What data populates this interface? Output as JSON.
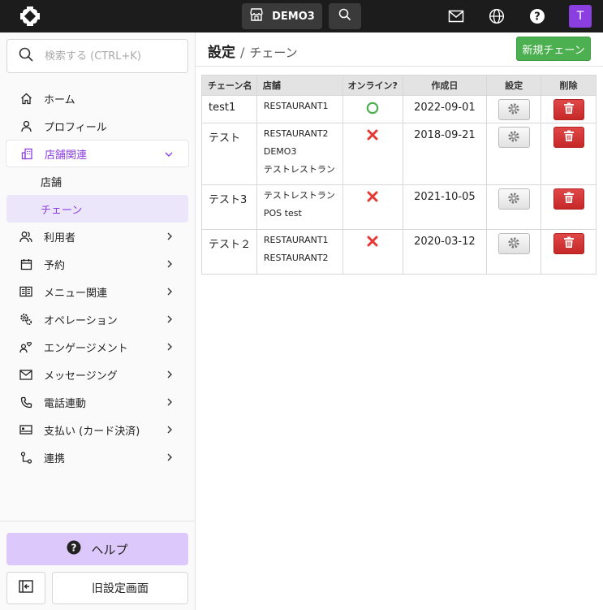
{
  "topbar": {
    "store_name": "DEMO3",
    "avatar_initial": "T"
  },
  "sidebar": {
    "search_placeholder": "検索する (CTRL+K)",
    "items": [
      {
        "label": "ホーム",
        "icon": "home-icon"
      },
      {
        "label": "プロフィール",
        "icon": "person-icon"
      },
      {
        "label": "店舗関連",
        "icon": "building-icon",
        "expanded": true
      },
      {
        "label": "利用者",
        "icon": "users-icon"
      },
      {
        "label": "予約",
        "icon": "calendar-icon"
      },
      {
        "label": "メニュー関連",
        "icon": "menu-book-icon"
      },
      {
        "label": "オペレーション",
        "icon": "gears-icon"
      },
      {
        "label": "エンゲージメント",
        "icon": "engagement-icon"
      },
      {
        "label": "メッセージング",
        "icon": "mail-icon"
      },
      {
        "label": "電話連動",
        "icon": "phone-icon"
      },
      {
        "label": "支払い (カード決済)",
        "icon": "payment-icon"
      },
      {
        "label": "連携",
        "icon": "integration-icon"
      }
    ],
    "sub_items": [
      {
        "label": "店舗",
        "active": false
      },
      {
        "label": "チェーン",
        "active": true
      }
    ],
    "help_label": "ヘルプ",
    "old_settings_label": "旧設定画面"
  },
  "main": {
    "breadcrumb": {
      "section": "設定",
      "separator": "/",
      "page": "チェーン"
    },
    "new_button_label": "新規チェーン",
    "table": {
      "headers": [
        "チェーン名",
        "店舗",
        "オンライン?",
        "作成日",
        "設定",
        "削除"
      ],
      "rows": [
        {
          "name": "test1",
          "stores": [
            "RESTAURANT1"
          ],
          "online": true,
          "created": "2022-09-01"
        },
        {
          "name": "テスト",
          "stores": [
            "RESTAURANT2",
            "DEMO3",
            "テストレストラン"
          ],
          "online": false,
          "created": "2018-09-21"
        },
        {
          "name": "テスト3",
          "stores": [
            "テストレストラン",
            "POS test"
          ],
          "online": false,
          "created": "2021-10-05"
        },
        {
          "name": "テスト２",
          "stores": [
            "RESTAURANT1",
            "RESTAURANT2"
          ],
          "online": false,
          "created": "2020-03-12"
        }
      ]
    }
  },
  "colors": {
    "accent": "#8b3fe0",
    "new_button": "#4caf50",
    "delete_button": "#d32f2f",
    "online": "#4caf50",
    "offline": "#e53935"
  }
}
